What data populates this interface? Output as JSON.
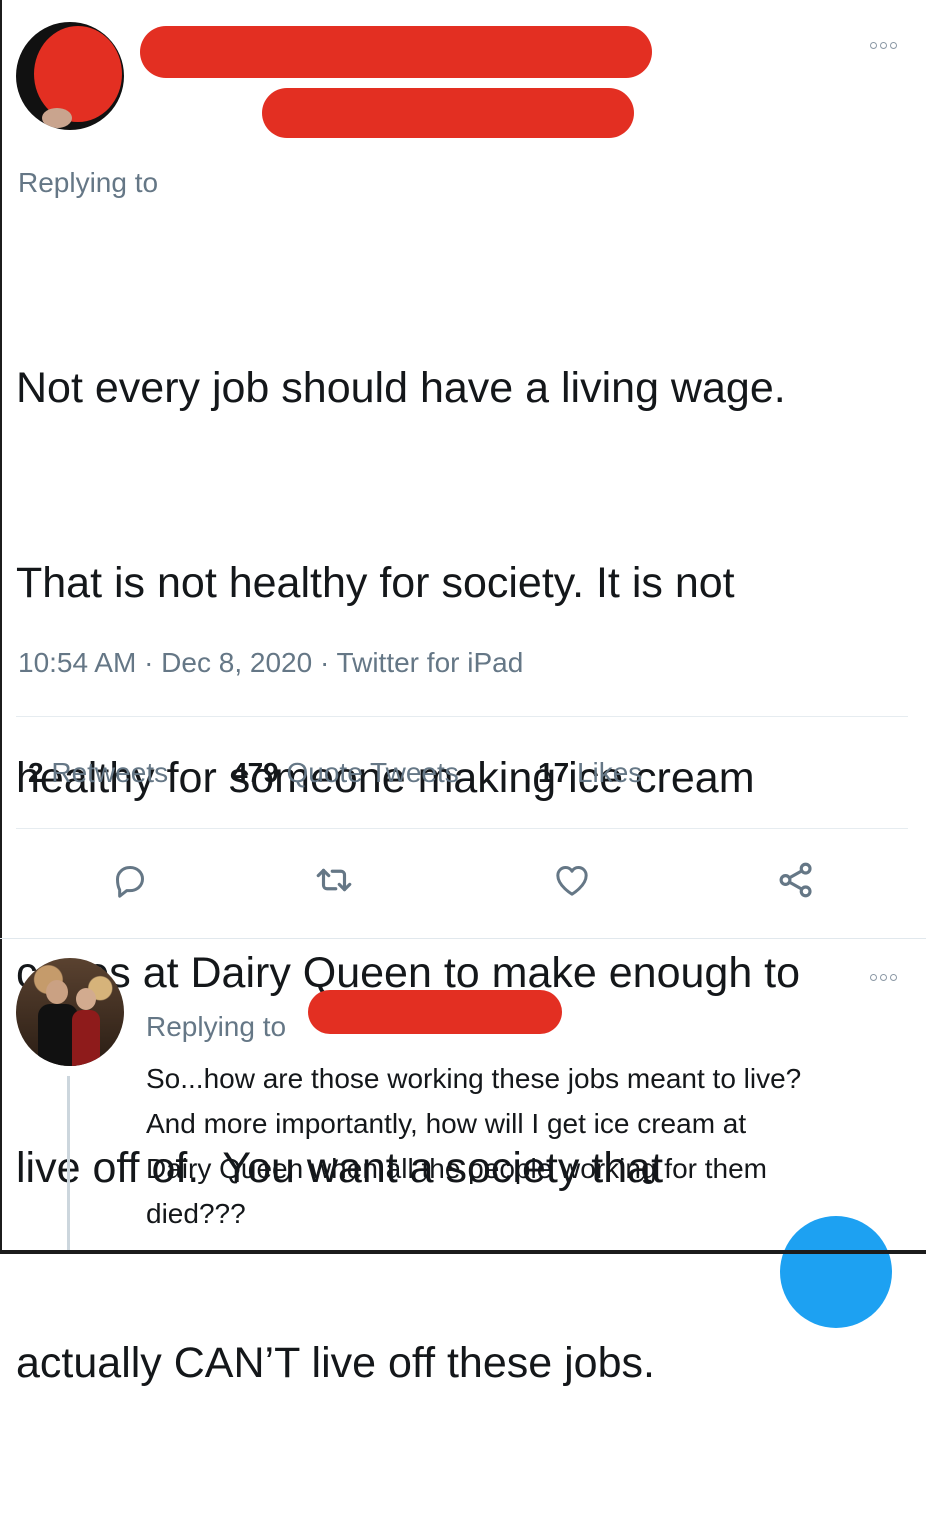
{
  "main_tweet": {
    "replying_label": "Replying to",
    "text_lines": [
      "Not every job should have a living wage.",
      "That is not healthy for society. It is not",
      "healthy for someone making ice cream",
      "cones at Dairy Queen to make enough to",
      "live off of.  You want a society that",
      "actually CAN’T live off these jobs."
    ],
    "meta": "10:54 AM · Dec 8, 2020 · Twitter for iPad",
    "stats": {
      "retweets_count": "2",
      "retweets_label": "Retweets",
      "quotes_count": "479",
      "quotes_label": "Quote Tweets",
      "likes_count": "17",
      "likes_label": "Likes"
    },
    "actions": [
      "reply-icon",
      "retweet-icon",
      "like-icon",
      "share-icon"
    ]
  },
  "reply_tweet": {
    "replying_label": "Replying to",
    "text_lines": [
      "So...how are those working these jobs meant to live?",
      "And more importantly, how will I get ice cream at",
      "Dairy Queen when all the people working for them",
      "died???"
    ]
  },
  "colors": {
    "redaction": "#e32f22",
    "muted_text": "#657786",
    "accent_blue": "#1da1f2"
  }
}
